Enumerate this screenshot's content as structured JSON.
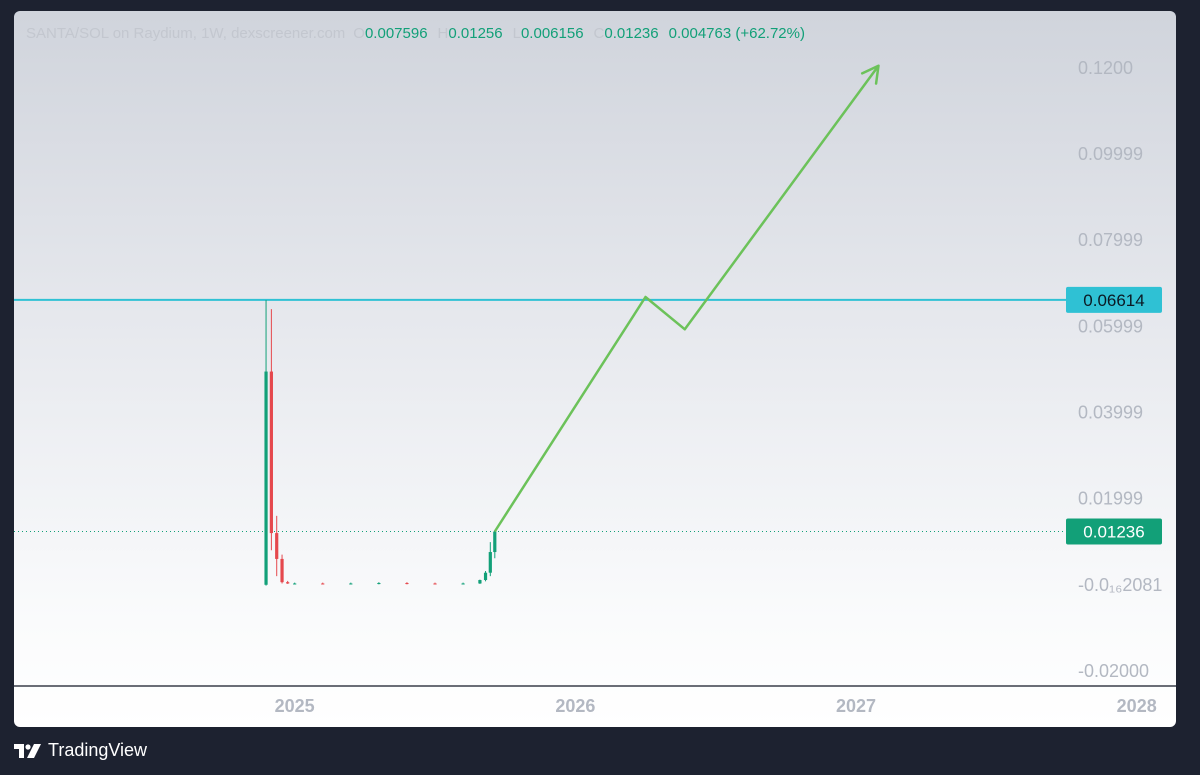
{
  "header": {
    "symbol": "SANTA/SOL on Raydium, 1W, dexscreener.com",
    "open_label": "O",
    "open": "0.007596",
    "high_label": "H",
    "high": "0.01256",
    "low_label": "L",
    "low": "0.006156",
    "close_label": "C",
    "close": "0.01236",
    "change": "0.004763 (+62.72%)"
  },
  "watermark": {
    "brand": "TradingView"
  },
  "chart_data": {
    "type": "candlestick",
    "y_tick_labels": [
      {
        "label": "0.1200",
        "value": 0.12
      },
      {
        "label": "0.09999",
        "value": 0.09999
      },
      {
        "label": "0.07999",
        "value": 0.07999
      },
      {
        "label": "0.05999",
        "value": 0.05999
      },
      {
        "label": "0.03999",
        "value": 0.03999
      },
      {
        "label": "0.01999",
        "value": 0.01999
      },
      {
        "label": "-0.0₁₆2081",
        "value": 0.0
      },
      {
        "label": "-0.02000",
        "value": -0.02
      }
    ],
    "x_tick_labels": [
      {
        "label": "2025",
        "value": 2025.0
      },
      {
        "label": "2026",
        "value": 2026.0
      },
      {
        "label": "2027",
        "value": 2027.0
      },
      {
        "label": "2028",
        "value": 2028.0
      }
    ],
    "xlim": [
      2024.0,
      2028.14
    ],
    "ylim": [
      -0.0235,
      0.1332
    ],
    "horizontal_line": {
      "value": 0.06614,
      "label": "0.06614",
      "color": "#2fc1d4"
    },
    "last_price": {
      "value": 0.01236,
      "label": "0.01236",
      "color": "#12a078"
    },
    "candles": [
      {
        "x": 2024.898,
        "o": 0.0,
        "h": 0.0661,
        "l": -0.0002,
        "c": 0.0495
      },
      {
        "x": 2024.917,
        "o": 0.0495,
        "h": 0.064,
        "l": 0.008,
        "c": 0.012
      },
      {
        "x": 2024.936,
        "o": 0.012,
        "h": 0.016,
        "l": 0.002,
        "c": 0.006
      },
      {
        "x": 2024.955,
        "o": 0.006,
        "h": 0.007,
        "l": 0.0003,
        "c": 0.0006
      },
      {
        "x": 2024.975,
        "o": 0.0006,
        "h": 0.0009,
        "l": 0.0002,
        "c": 0.0003
      },
      {
        "x": 2025.0,
        "o": 0.0003,
        "h": 0.0005,
        "l": 0.0001,
        "c": 0.0003
      },
      {
        "x": 2025.1,
        "o": 0.0003,
        "h": 0.0005,
        "l": 0.0001,
        "c": 0.0002
      },
      {
        "x": 2025.2,
        "o": 0.0002,
        "h": 0.0005,
        "l": 0.0001,
        "c": 0.0003
      },
      {
        "x": 2025.3,
        "o": 0.0003,
        "h": 0.0006,
        "l": 0.0001,
        "c": 0.0004
      },
      {
        "x": 2025.4,
        "o": 0.0004,
        "h": 0.0006,
        "l": 0.0001,
        "c": 0.0003
      },
      {
        "x": 2025.5,
        "o": 0.0003,
        "h": 0.0005,
        "l": 0.0001,
        "c": 0.0002
      },
      {
        "x": 2025.6,
        "o": 0.0002,
        "h": 0.0005,
        "l": 0.0001,
        "c": 0.0003
      },
      {
        "x": 2025.66,
        "o": 0.0003,
        "h": 0.0012,
        "l": 0.0002,
        "c": 0.0011
      },
      {
        "x": 2025.68,
        "o": 0.0011,
        "h": 0.0032,
        "l": 0.0008,
        "c": 0.0028
      },
      {
        "x": 2025.697,
        "o": 0.0028,
        "h": 0.0099,
        "l": 0.002,
        "c": 0.0076
      },
      {
        "x": 2025.713,
        "o": 0.0076,
        "h": 0.01256,
        "l": 0.006156,
        "c": 0.01236
      }
    ],
    "projection_path": [
      {
        "x": 2025.713,
        "y": 0.01236
      },
      {
        "x": 2026.25,
        "y": 0.0668
      },
      {
        "x": 2026.39,
        "y": 0.0593
      },
      {
        "x": 2027.08,
        "y": 0.1205
      }
    ],
    "colors": {
      "up": "#12a078",
      "down": "#e5484d",
      "projection": "#6cc25a",
      "axis_text": "#b3b8c2"
    }
  }
}
